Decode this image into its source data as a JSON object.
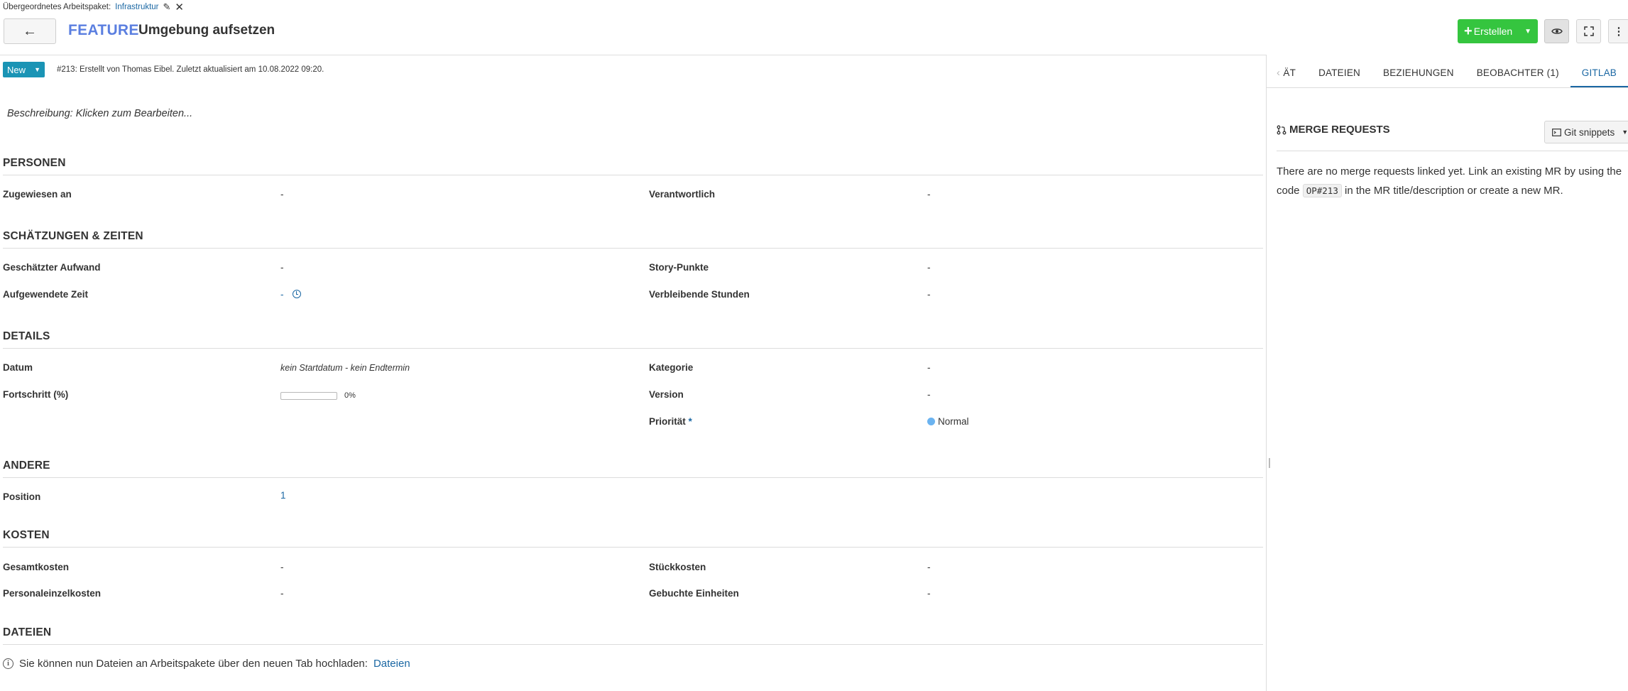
{
  "parent": {
    "label": "Übergeordnetes Arbeitspaket:",
    "link": "Infrastruktur"
  },
  "header": {
    "back_icon": "←",
    "type": "FEATURE",
    "title": "Umgebung aufsetzen",
    "create_label": "Erstellen"
  },
  "status": {
    "label": "New",
    "meta": "#213: Erstellt von Thomas Eibel. Zuletzt aktualisiert am 10.08.2022 09:20."
  },
  "description": "Beschreibung: Klicken zum Bearbeiten...",
  "sections": {
    "personen": "PERSONEN",
    "schaetzungen": "SCHÄTZUNGEN & ZEITEN",
    "details": "DETAILS",
    "andere": "ANDERE",
    "kosten": "KOSTEN",
    "dateien": "DATEIEN"
  },
  "fields": {
    "zugewiesen": {
      "label": "Zugewiesen an",
      "value": "-"
    },
    "verantwortlich": {
      "label": "Verantwortlich",
      "value": "-"
    },
    "geschaetzt": {
      "label": "Geschätzter Aufwand",
      "value": "-"
    },
    "story": {
      "label": "Story-Punkte",
      "value": "-"
    },
    "aufgewendet": {
      "label": "Aufgewendete Zeit",
      "value": "-"
    },
    "verbleibend": {
      "label": "Verbleibende Stunden",
      "value": "-"
    },
    "datum": {
      "label": "Datum",
      "value": "kein Startdatum - kein Endtermin"
    },
    "kategorie": {
      "label": "Kategorie",
      "value": "-"
    },
    "fortschritt": {
      "label": "Fortschritt (%)",
      "value": "0%",
      "percent": 0
    },
    "version": {
      "label": "Version",
      "value": "-"
    },
    "prioritaet": {
      "label": "Priorität",
      "required": "*",
      "value": "Normal",
      "color": "#6bb3f0"
    },
    "position": {
      "label": "Position",
      "value": "1"
    },
    "gesamtkosten": {
      "label": "Gesamtkosten",
      "value": "-"
    },
    "stueckkosten": {
      "label": "Stückkosten",
      "value": "-"
    },
    "personaleinzel": {
      "label": "Personaleinzelkosten",
      "value": "-"
    },
    "einheiten": {
      "label": "Gebuchte Einheiten",
      "value": "-"
    }
  },
  "notice": {
    "text": "Sie können nun Dateien an Arbeitspakete über den neuen Tab hochladen:",
    "link": "Dateien"
  },
  "right_pane": {
    "tabs": [
      "ÄT",
      "DATEIEN",
      "BEZIEHUNGEN",
      "BEOBACHTER (1)",
      "GITLAB"
    ],
    "active_tab": "GITLAB",
    "mr_title": "MERGE REQUESTS",
    "snippets_label": "Git snippets",
    "mr_text_1": "There are no merge requests linked yet. Link an existing MR by using the",
    "mr_text_2": "code",
    "mr_code": "OP#213",
    "mr_text_3": "in the MR title/description or create a new MR."
  },
  "colors": {
    "accent": "#1a67a3",
    "create": "#35c53f",
    "status": "#1a94b5",
    "type": "#5b7fe0"
  }
}
